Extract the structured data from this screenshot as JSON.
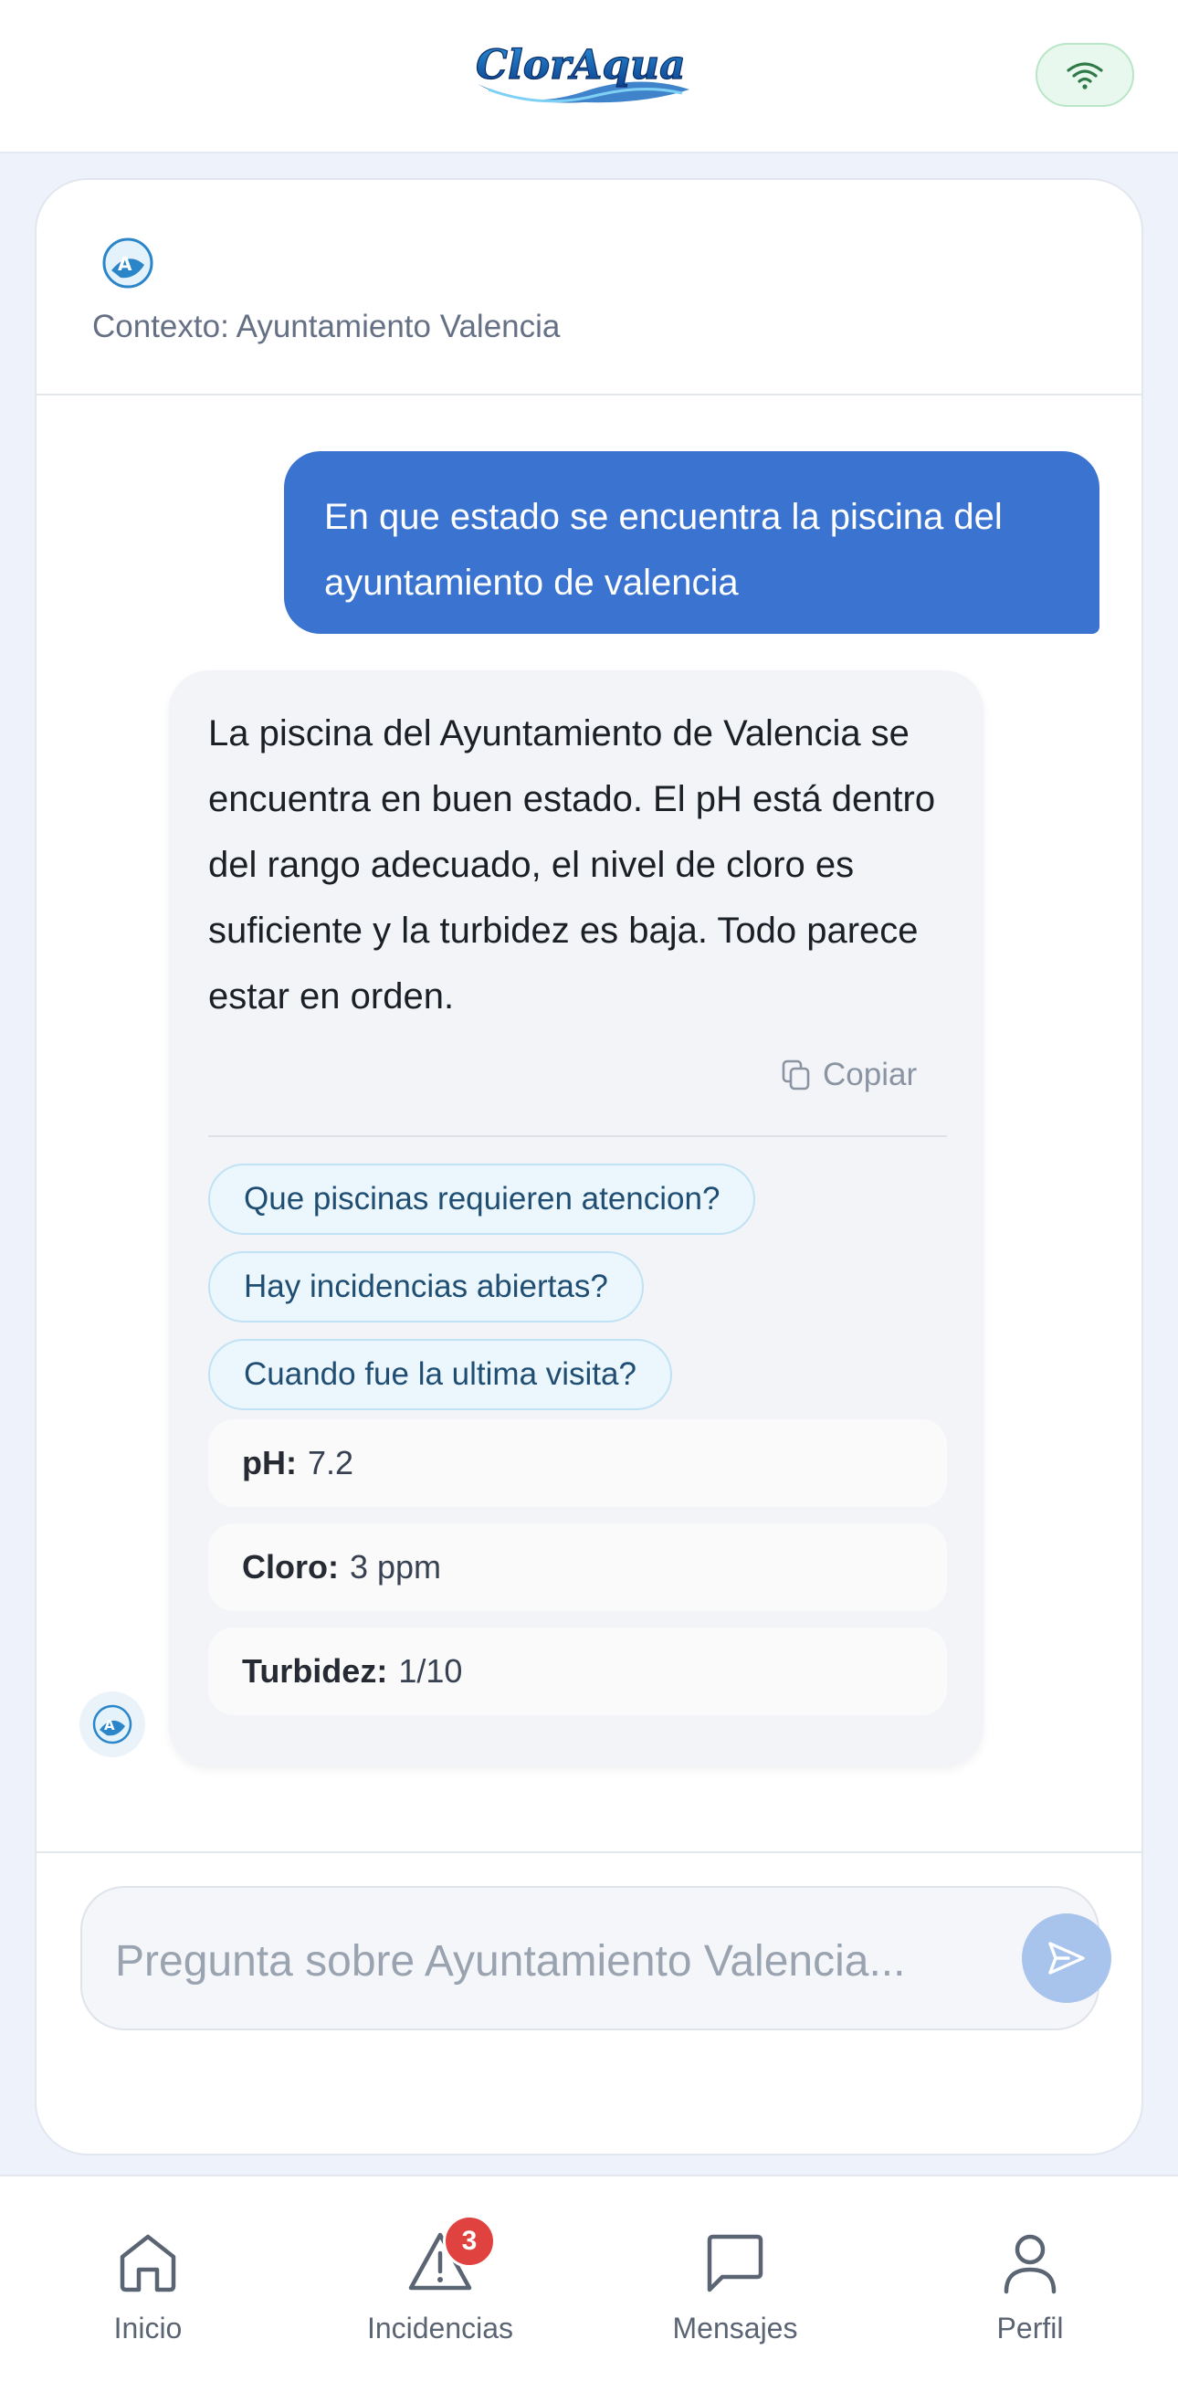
{
  "header": {
    "logo_text": "ClorAqua",
    "connection_icon": "wifi-icon"
  },
  "context": {
    "label": "Contexto: Ayuntamiento Valencia"
  },
  "messages": {
    "user": "En que estado se encuentra la piscina del ayuntamiento de valencia",
    "assistant": "La piscina del Ayuntamiento de Valencia se encuentra en buen estado. El pH está dentro del rango adecuado, el nivel de cloro es suficiente y la turbidez es baja. Todo parece estar en orden.",
    "copy_label": "Copiar"
  },
  "suggestions": [
    "Que piscinas requieren atencion?",
    "Hay incidencias abiertas?",
    "Cuando fue la ultima visita?"
  ],
  "metrics": [
    {
      "label": "pH:",
      "value": "7.2"
    },
    {
      "label": "Cloro:",
      "value": "3 ppm"
    },
    {
      "label": "Turbidez:",
      "value": "1/10"
    }
  ],
  "input": {
    "placeholder": "Pregunta sobre Ayuntamiento Valencia...",
    "value": ""
  },
  "nav": {
    "items": [
      {
        "label": "Inicio",
        "icon": "home-icon"
      },
      {
        "label": "Incidencias",
        "icon": "alert-triangle-icon"
      },
      {
        "label": "Mensajes",
        "icon": "message-icon"
      },
      {
        "label": "Perfil",
        "icon": "user-icon"
      }
    ],
    "incidencias_badge": "3"
  },
  "colors": {
    "accent": "#3a73d0",
    "badge": "#e0433f",
    "chip_text": "#1f4e72"
  }
}
